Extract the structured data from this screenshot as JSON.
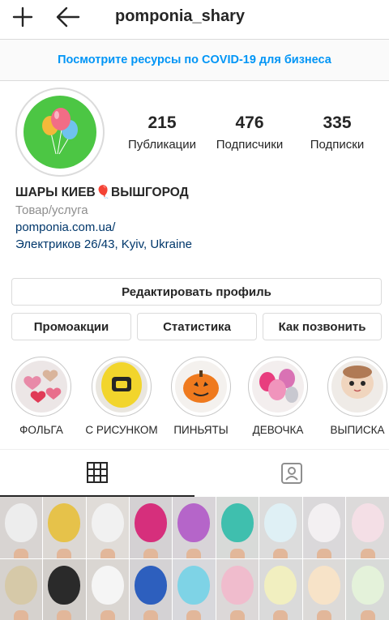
{
  "header": {
    "username": "pomponia_shary",
    "icons": [
      "plus-icon",
      "back-arrow-icon"
    ]
  },
  "banner": {
    "text": "Посмотрите ресурсы по COVID-19 для бизнеса"
  },
  "stats": {
    "posts": {
      "value": "215",
      "label": "Публикации"
    },
    "followers": {
      "value": "476",
      "label": "Подписчики"
    },
    "following": {
      "value": "335",
      "label": "Подписки"
    }
  },
  "bio": {
    "name": "ШАРЫ КИЕВ🎈ВЫШГОРОД",
    "category": "Товар/услуга",
    "website": "pomponia.com.ua/",
    "address": "Электриков 26/43, Kyiv, Ukraine"
  },
  "buttons": {
    "edit_profile": "Редактировать профиль",
    "promotions": "Промоакции",
    "insights": "Статистика",
    "contact": "Как позвонить"
  },
  "highlights": [
    {
      "label": "ФОЛЬГА"
    },
    {
      "label": "С РИСУНКОМ"
    },
    {
      "label": "ПИНЬЯТЫ"
    },
    {
      "label": "ДЕВОЧКА"
    },
    {
      "label": "ВЫПИСКА"
    }
  ],
  "tabs": {
    "active": "grid",
    "icons": [
      "grid-icon",
      "tagged-icon"
    ]
  },
  "colors": {
    "accent_blue": "#0095f6",
    "link_blue": "#00376b",
    "avatar_green": "#4cc644",
    "border": "#dbdbdb"
  }
}
